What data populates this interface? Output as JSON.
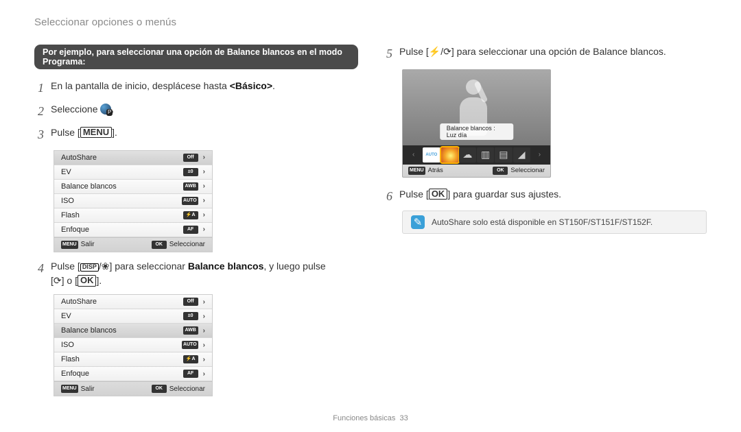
{
  "header": "Seleccionar opciones o menús",
  "left": {
    "example_pill": "Por ejemplo, para seleccionar una opción de Balance blancos en el modo Programa:",
    "step1_a": "En la pantalla de inicio, desplácese hasta ",
    "step1_b": "<Básico>",
    "step1_c": ".",
    "step2_a": "Seleccione ",
    "step2_b": ".",
    "step3_a": "Pulse [",
    "step3_key": "MENU",
    "step3_b": "].",
    "menuA": {
      "items": [
        {
          "label": "AutoShare",
          "icon": "Off"
        },
        {
          "label": "EV",
          "icon": "±0"
        },
        {
          "label": "Balance blancos",
          "icon": "AWB"
        },
        {
          "label": "ISO",
          "icon": "AUTO"
        },
        {
          "label": "Flash",
          "icon": "⚡A"
        },
        {
          "label": "Enfoque",
          "icon": "AF"
        }
      ],
      "foot_left_key": "MENU",
      "foot_left": "Salir",
      "foot_right_key": "OK",
      "foot_right": "Seleccionar"
    },
    "step4_a": "Pulse [",
    "step4_disp": "DISP",
    "step4_slash": "/",
    "step4_flower": "❀",
    "step4_b": "] para seleccionar ",
    "step4_bold": "Balance blancos",
    "step4_c": ", y luego pulse",
    "step4_line2_a": "[",
    "step4_timer": "⟳",
    "step4_line2_b": "] o [",
    "step4_ok": "OK",
    "step4_line2_c": "].",
    "menuB": {
      "items": [
        {
          "label": "AutoShare",
          "icon": "Off"
        },
        {
          "label": "EV",
          "icon": "±0"
        },
        {
          "label": "Balance blancos",
          "icon": "AWB",
          "selected": true
        },
        {
          "label": "ISO",
          "icon": "AUTO"
        },
        {
          "label": "Flash",
          "icon": "⚡A"
        },
        {
          "label": "Enfoque",
          "icon": "AF"
        }
      ],
      "foot_left_key": "MENU",
      "foot_left": "Salir",
      "foot_right_key": "OK",
      "foot_right": "Seleccionar"
    }
  },
  "right": {
    "step5_a": "Pulse [",
    "step5_flash": "⚡",
    "step5_slash": "/",
    "step5_timer": "⟳",
    "step5_b": "] para seleccionar una opción de Balance blancos.",
    "preview_label": "Balance blancos : Luz día",
    "preview_foot_left_key": "MENU",
    "preview_foot_left": "Atrás",
    "preview_foot_right_key": "OK",
    "preview_foot_right": "Seleccionar",
    "wb_auto": "AUTO",
    "step6_a": "Pulse [",
    "step6_ok": "OK",
    "step6_b": "] para guardar sus ajustes.",
    "note_icon": "✎",
    "note_text": "AutoShare solo está disponible en ST150F/ST151F/ST152F."
  },
  "footer": {
    "label": "Funciones básicas",
    "page": "33"
  }
}
